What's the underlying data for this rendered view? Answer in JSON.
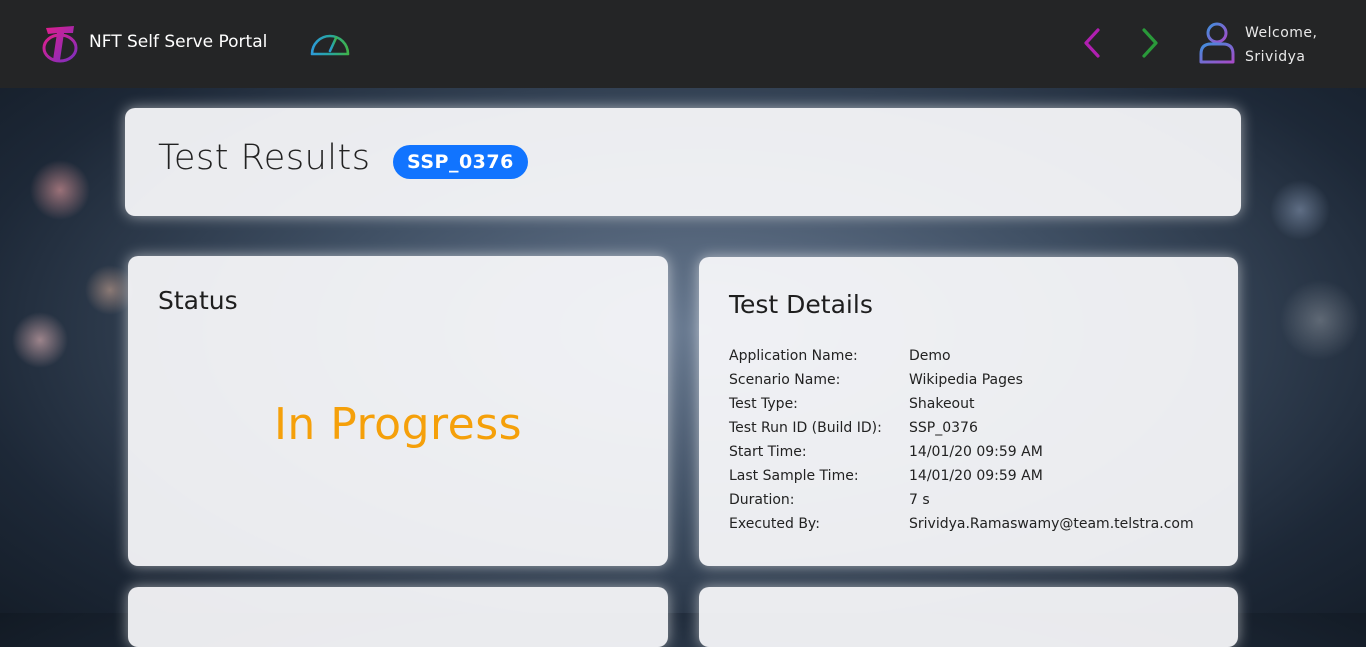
{
  "header": {
    "app_title": "NFT Self Serve Portal",
    "welcome_line1": "Welcome,",
    "welcome_line2": "Srividya"
  },
  "icons": {
    "brand": "telstra-logo-icon",
    "dashboard": "speedometer-icon",
    "back": "chevron-left-icon",
    "forward": "chevron-right-icon",
    "user": "user-icon"
  },
  "colors": {
    "back_arrow": "#b01fb0",
    "forward_arrow": "#2a9a3a",
    "badge": "#1174ff",
    "status": "#f5a00a"
  },
  "page": {
    "title": "Test Results",
    "run_id_badge": "SSP_0376"
  },
  "status": {
    "heading": "Status",
    "value": "In Progress"
  },
  "details": {
    "heading": "Test Details",
    "rows": [
      {
        "label": "Application Name:",
        "value": "Demo"
      },
      {
        "label": "Scenario Name:",
        "value": "Wikipedia Pages"
      },
      {
        "label": "Test Type:",
        "value": "Shakeout"
      },
      {
        "label": "Test Run ID (Build ID):",
        "value": "SSP_0376"
      },
      {
        "label": "Start Time:",
        "value": "14/01/20 09:59 AM"
      },
      {
        "label": "Last Sample Time:",
        "value": "14/01/20 09:59 AM"
      },
      {
        "label": "Duration:",
        "value": "7 s"
      },
      {
        "label": "Executed By:",
        "value": "Srividya.Ramaswamy@team.telstra.com"
      }
    ]
  }
}
